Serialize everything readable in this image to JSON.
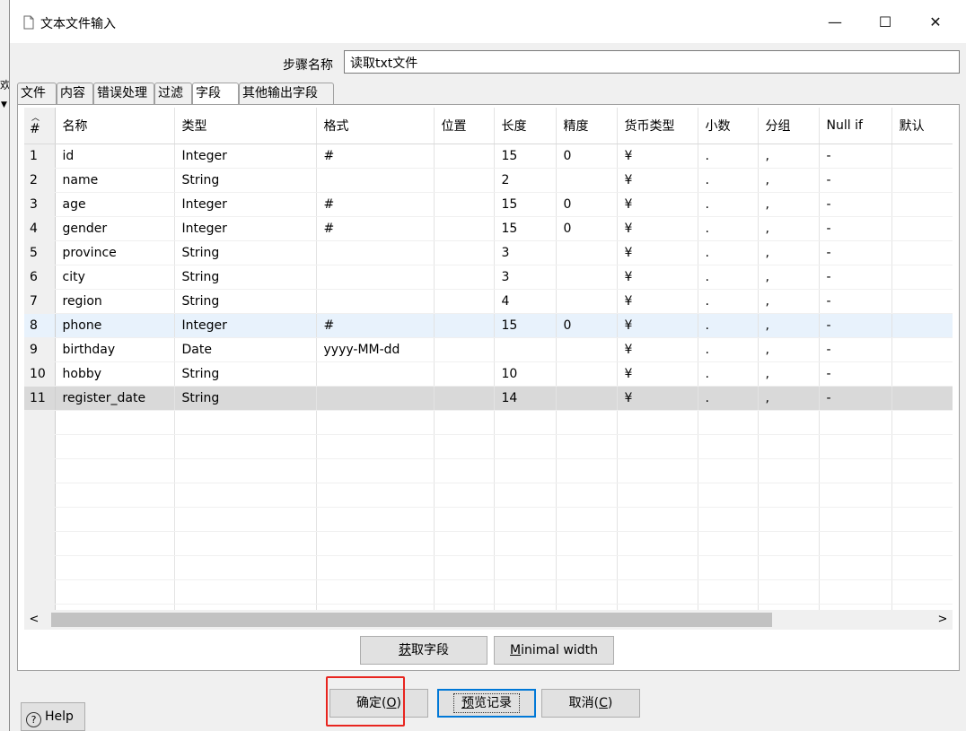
{
  "window": {
    "title": "文本文件输入",
    "controls": {
      "minimize": "—",
      "maximize": "☐",
      "close": "✕"
    }
  },
  "step": {
    "label": "步骤名称",
    "value": "读取txt文件"
  },
  "background_fragment": "欢",
  "tabs": [
    {
      "label": "文件",
      "active": false
    },
    {
      "label": "内容",
      "active": false
    },
    {
      "label": "错误处理",
      "active": false
    },
    {
      "label": "过滤",
      "active": false
    },
    {
      "label": "字段",
      "active": true
    },
    {
      "label": "其他输出字段",
      "active": false
    }
  ],
  "grid": {
    "columns": [
      "#",
      "名称",
      "类型",
      "格式",
      "位置",
      "长度",
      "精度",
      "货币类型",
      "小数",
      "分组",
      "Null if",
      "默认"
    ],
    "rows": [
      [
        "1",
        "id",
        "Integer",
        "#",
        "",
        "15",
        "0",
        "¥",
        ".",
        ",",
        "-",
        ""
      ],
      [
        "2",
        "name",
        "String",
        "",
        "",
        "2",
        "",
        "¥",
        ".",
        ",",
        "-",
        ""
      ],
      [
        "3",
        "age",
        "Integer",
        "#",
        "",
        "15",
        "0",
        "¥",
        ".",
        ",",
        "-",
        ""
      ],
      [
        "4",
        "gender",
        "Integer",
        "#",
        "",
        "15",
        "0",
        "¥",
        ".",
        ",",
        "-",
        ""
      ],
      [
        "5",
        "province",
        "String",
        "",
        "",
        "3",
        "",
        "¥",
        ".",
        ",",
        "-",
        ""
      ],
      [
        "6",
        "city",
        "String",
        "",
        "",
        "3",
        "",
        "¥",
        ".",
        ",",
        "-",
        ""
      ],
      [
        "7",
        "region",
        "String",
        "",
        "",
        "4",
        "",
        "¥",
        ".",
        ",",
        "-",
        ""
      ],
      [
        "8",
        "phone",
        "Integer",
        "#",
        "",
        "15",
        "0",
        "¥",
        ".",
        ",",
        "-",
        ""
      ],
      [
        "9",
        "birthday",
        "Date",
        "yyyy-MM-dd",
        "",
        "",
        "",
        "¥",
        ".",
        ",",
        "-",
        ""
      ],
      [
        "10",
        "hobby",
        "String",
        "",
        "",
        "10",
        "",
        "¥",
        ".",
        ",",
        "-",
        ""
      ],
      [
        "11",
        "register_date",
        "String",
        "",
        "",
        "14",
        "",
        "¥",
        ".",
        ",",
        "-",
        ""
      ]
    ],
    "highlight_light_row": 8,
    "highlight_grey_row": 11
  },
  "buttons": {
    "get_fields": {
      "text": "获取字段",
      "mnemonic": "获"
    },
    "minimal_width": {
      "mnemonic": "M",
      "rest": "inimal width"
    },
    "ok": {
      "text": "确定(",
      "mnemonic": "O",
      "suffix": ")"
    },
    "preview": {
      "mnemonic": "预",
      "rest": "览记录"
    },
    "cancel": {
      "text": "取消(",
      "mnemonic": "C",
      "suffix": ")"
    },
    "help": "Help"
  },
  "colors": {
    "highlight_box": "#e8251f",
    "default_button_border": "#0078d7"
  }
}
